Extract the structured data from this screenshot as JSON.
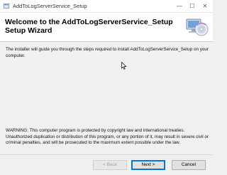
{
  "window": {
    "title": "AddToLogServerService_Setup",
    "minimize_glyph": "—",
    "maximize_glyph": "☐",
    "close_glyph": "✕"
  },
  "header": {
    "title": "Welcome to the AddToLogServerService_Setup Setup Wizard",
    "art_icon": "computer-disc-icon"
  },
  "body": {
    "intro": "The installer will guide you through the steps required to install AddToLogServerService_Setup on your computer.",
    "warning": "WARNING: This computer program is protected by copyright law and international treaties. Unauthorized duplication or distribution of this program, or any portion of it, may result in severe civil or criminal penalties, and will be prosecuted to the maximum extent possible under the law."
  },
  "buttons": {
    "back": "< Back",
    "next": "Next >",
    "cancel": "Cancel"
  },
  "colors": {
    "accent": "#0078d7",
    "background": "#f0f0f0",
    "header_bg": "#ffffff"
  }
}
